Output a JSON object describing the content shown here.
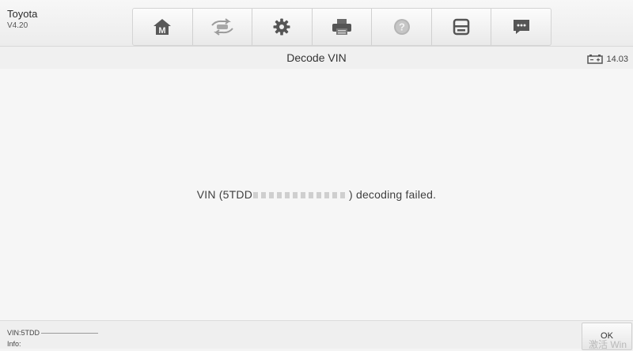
{
  "app": {
    "name": "Toyota",
    "version": "V4.20"
  },
  "toolbar": {
    "buttons": [
      {
        "icon": "home-icon",
        "glyph": "M"
      },
      {
        "icon": "vehicle-swap-icon"
      },
      {
        "icon": "gear-icon"
      },
      {
        "icon": "printer-icon"
      },
      {
        "icon": "help-icon",
        "glyph": "?"
      },
      {
        "icon": "save-icon"
      },
      {
        "icon": "message-icon"
      }
    ]
  },
  "titlebar": {
    "title": "Decode VIN",
    "battery_voltage": "14.03"
  },
  "content": {
    "message_prefix": "VIN  (5TDD",
    "message_suffix": ")  decoding failed."
  },
  "footer": {
    "vin_label": "VIN:5TDD",
    "info_label": "Info:",
    "ok_label": "OK"
  },
  "watermark": "激活 Win",
  "colors": {
    "background": "#f4f4f4",
    "text": "#404040",
    "icon": "#555555"
  }
}
